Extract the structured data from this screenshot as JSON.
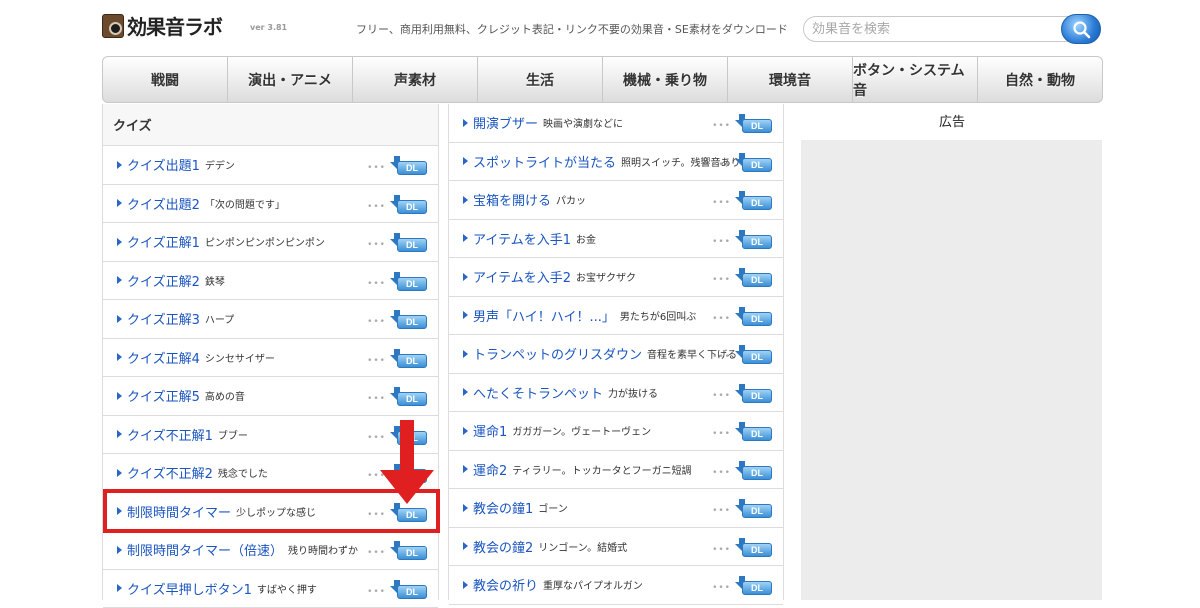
{
  "header": {
    "logo_text": "効果音ラボ",
    "version": "ver 3.81",
    "tagline": "フリー、商用利用無料、クレジット表記・リンク不要の効果音・SE素材をダウンロード",
    "search_placeholder": "効果音を検索"
  },
  "nav": {
    "items": [
      "戦闘",
      "演出・アニメ",
      "声素材",
      "生活",
      "機械・乗り物",
      "環境音",
      "ボタン・システム音",
      "自然・動物"
    ]
  },
  "left_column": {
    "title": "クイズ",
    "items": [
      {
        "title": "クイズ出題1",
        "desc": "デデン"
      },
      {
        "title": "クイズ出題2",
        "desc": "「次の問題です」"
      },
      {
        "title": "クイズ正解1",
        "desc": "ピンポンピンポンピンポン"
      },
      {
        "title": "クイズ正解2",
        "desc": "鉄琴"
      },
      {
        "title": "クイズ正解3",
        "desc": "ハープ"
      },
      {
        "title": "クイズ正解4",
        "desc": "シンセサイザー"
      },
      {
        "title": "クイズ正解5",
        "desc": "高めの音"
      },
      {
        "title": "クイズ不正解1",
        "desc": "ブブー"
      },
      {
        "title": "クイズ不正解2",
        "desc": "残念でした"
      },
      {
        "title": "制限時間タイマー",
        "desc": "少しポップな感じ"
      },
      {
        "title": "制限時間タイマー（倍速）",
        "desc": "残り時間わずか"
      },
      {
        "title": "クイズ早押しボタン1",
        "desc": "すばやく押す"
      }
    ]
  },
  "middle_column": {
    "items": [
      {
        "title": "開演ブザー",
        "desc": "映画や演劇などに"
      },
      {
        "title": "スポットライトが当たる",
        "desc": "照明スイッチ。残響音あり"
      },
      {
        "title": "宝箱を開ける",
        "desc": "パカッ"
      },
      {
        "title": "アイテムを入手1",
        "desc": "お金"
      },
      {
        "title": "アイテムを入手2",
        "desc": "お宝ザクザク"
      },
      {
        "title": "男声「ハイ！ハイ！...」",
        "desc": "男たちが6回叫ぶ"
      },
      {
        "title": "トランペットのグリスダウン",
        "desc": "音程を素早く下げる"
      },
      {
        "title": "へたくそトランペット",
        "desc": "力が抜ける"
      },
      {
        "title": "運命1",
        "desc": "ガガガーン。ヴェートーヴェン"
      },
      {
        "title": "運命2",
        "desc": "ティラリー。トッカータとフーガニ短調"
      },
      {
        "title": "教会の鐘1",
        "desc": "ゴーン"
      },
      {
        "title": "教会の鐘2",
        "desc": "リンゴーン。結婚式"
      },
      {
        "title": "教会の祈り",
        "desc": "重厚なパイプオルガン"
      }
    ]
  },
  "dl_label": "DL",
  "dots": "•••",
  "right_column": {
    "ad_label": "広告"
  },
  "colors": {
    "link": "#1a55c0",
    "highlight": "#e02020",
    "dl_badge": "#3b8fd6"
  }
}
